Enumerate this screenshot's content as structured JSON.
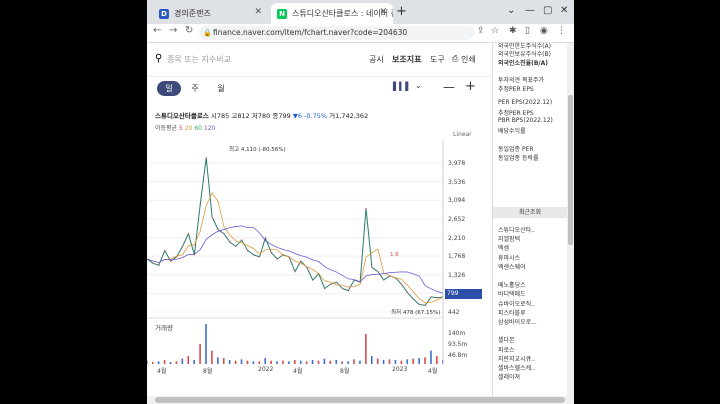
{
  "tabs": [
    {
      "label": "경의준랜즈",
      "favicon": "D",
      "favicon_color": "#2b59c3"
    },
    {
      "label": "스튜디오산타클로스 : 네이버 증",
      "favicon": "N",
      "favicon_color": "#03c75a"
    }
  ],
  "address": {
    "url": "finance.naver.com/item/fchart.naver?code=204630"
  },
  "toolbar": {
    "search_placeholder": "종목 또는 지수비교",
    "items": [
      "공시",
      "보조지표",
      "도구",
      "인쇄"
    ]
  },
  "period": {
    "buttons": [
      "일",
      "주",
      "월"
    ],
    "selected": 0
  },
  "stock": {
    "name": "스튜디오산타클로스",
    "open_label": "시",
    "open": "785",
    "high_label": "고",
    "high": "812",
    "low_label": "저",
    "low": "780",
    "close_label": "종",
    "close": "799",
    "change": "▼6",
    "change_pct": "-0.75%",
    "volume_label": "거",
    "volume": "1,742,362"
  },
  "ma": {
    "label": "이동평균",
    "p5": "5",
    "p20": "20",
    "p60": "60",
    "p120": "120"
  },
  "scale_label": "Linear",
  "annotations": {
    "high": "최고 4,110 (-80.56%)",
    "low": "최저 478 (67.15%)",
    "mid": "1.6"
  },
  "current_price": "799",
  "volume_panel": {
    "label": "거래량",
    "ticks": [
      "140m",
      "93.5m",
      "46.8m"
    ]
  },
  "chart_data": {
    "type": "line",
    "y_ticks": [
      3978,
      3536,
      3094,
      2652,
      2210,
      1768,
      1326,
      884,
      442
    ],
    "x_ticks": [
      "4월",
      "8월",
      "2022",
      "4월",
      "8월",
      "2023",
      "4월"
    ],
    "x": [
      0,
      2,
      4,
      6,
      8,
      10,
      12,
      14,
      16,
      18,
      20,
      22,
      24,
      26,
      28,
      30,
      32,
      34,
      36,
      38,
      40,
      42,
      44,
      46,
      48,
      50,
      52,
      54,
      56,
      58,
      60,
      62,
      64,
      66,
      68,
      70,
      72,
      74,
      76,
      78,
      80,
      82,
      84,
      86,
      88,
      90,
      92,
      94,
      96,
      98,
      100
    ],
    "series": [
      {
        "values": [
          1700,
          1600,
          1550,
          1900,
          1650,
          1750,
          2000,
          2300,
          1800,
          3000,
          4100,
          2700,
          2400,
          2300,
          2100,
          2000,
          2150,
          1900,
          1800,
          1750,
          2200,
          1850,
          1700,
          1800,
          1750,
          1400,
          1650,
          1500,
          1200,
          1350,
          1000,
          1100,
          1150,
          1000,
          950,
          1200,
          1150,
          2900,
          1500,
          1400,
          1200,
          1300,
          1250,
          1100,
          900,
          750,
          620,
          600,
          800,
          780,
          799
        ]
      }
    ],
    "volume": [
      5,
      3,
      4,
      6,
      3,
      4,
      8,
      12,
      6,
      30,
      60,
      20,
      10,
      9,
      6,
      5,
      7,
      5,
      4,
      4,
      9,
      5,
      4,
      5,
      4,
      6,
      5,
      4,
      6,
      5,
      8,
      5,
      6,
      4,
      4,
      7,
      5,
      45,
      12,
      8,
      6,
      7,
      6,
      5,
      7,
      8,
      9,
      10,
      20,
      12,
      6
    ],
    "high_point": {
      "value": 4110,
      "label": "최고 4,110 (-80.56%)"
    },
    "low_point": {
      "value": 478,
      "label": "최저 478 (67.15%)"
    }
  },
  "sidebar": {
    "top": [
      "외국인한도주식수(A)",
      "외국인보유주식수(B)",
      "외국인소진율(B/A)"
    ],
    "mid": [
      "투자의견  목표주가",
      "추정PER  EPS"
    ],
    "per": [
      "PER  EPS(2022.12)",
      "추정PER  EPS",
      "PBR  BPS(2022.12)",
      "배당수익률"
    ],
    "same": [
      "동일업종 PER",
      "동일업종 등락률"
    ],
    "recent_label": "최근조회",
    "recent": [
      "스튜디오산타..",
      "지엘팜텍",
      "엑셈",
      "휴마시스",
      "엑센스웨어",
      "",
      "베노홀딩스",
      "바디텍메드",
      "슈바이오로직..",
      "피스타블루",
      "삼성바이오로...",
      "",
      "셀다본",
      "파로스",
      "지란지교시큐..",
      "셀바스헬스케..",
      "셀레이져"
    ],
    "colors": {
      "link": "#1a4fb3"
    }
  }
}
